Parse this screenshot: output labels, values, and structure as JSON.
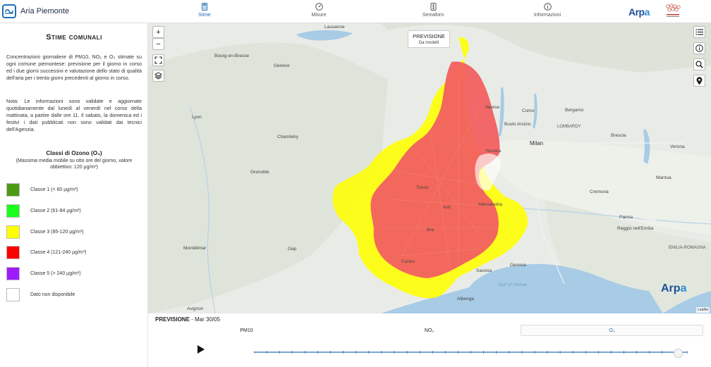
{
  "app": {
    "title": "Aria Piemonte"
  },
  "nav": {
    "tabs": [
      {
        "label": "Stime",
        "icon": "calculator-icon",
        "active": true
      },
      {
        "label": "Misure",
        "icon": "gauge-icon",
        "active": false
      },
      {
        "label": "Semaforo",
        "icon": "traffic-light-icon",
        "active": false
      },
      {
        "label": "Informazioni",
        "icon": "info-icon",
        "active": false
      }
    ],
    "logo_text_a": "Arp",
    "logo_text_b": "a"
  },
  "sidebar": {
    "title": "Stime comunali",
    "intro": "Concentrazioni giornaliere di PM10, NO₂ e O₃ stimate su ogni comune piemontese: previsione per il giorno in corso ed i due giorni successivi e valutazione dello stato di qualità dell'aria per i trenta giorni precedenti al giorno in corso.",
    "note": "Nota: Le informazioni sono validate e aggiornate quotidianamente dal lunedì al venerdì nel corso della mattinata, a partire dalle ore 11. Il sabato, la domenica ed i festivi i dati pubblicati non sono validati dai tecnici dell'Agenzia.",
    "legend_title": "Classi di Ozono (O₃)",
    "legend_subtitle": "(Massima media mobile su otto ore del giorno, valore obbiettivo: 120 µg/m³)",
    "legend": [
      {
        "label": "Classe 1 (< 60 µg/m³)",
        "color": "#4c9a14"
      },
      {
        "label": "Classe 2 (61-84 µg/m³)",
        "color": "#19ff19"
      },
      {
        "label": "Classe 3 (85-120 µg/m³)",
        "color": "#ffff00"
      },
      {
        "label": "Classe 4 (121-240 µg/m³)",
        "color": "#ff0000"
      },
      {
        "label": "Classe 5 (> 240 µg/m³)",
        "color": "#a01aff"
      },
      {
        "label": "Dato non disponibile",
        "color": "#ffffff"
      }
    ]
  },
  "map": {
    "badge_title": "PREVISIONE",
    "badge_sub": "Da modelli",
    "zoom_in": "+",
    "zoom_out": "−",
    "attribution": "Leaflet",
    "labels": {
      "lausanne": "Lausanne",
      "geneva": "Genève",
      "lyon": "Lyon",
      "chambery": "Chambéry",
      "grenoble": "Grenoble",
      "milan": "Milan",
      "torino": "Torino",
      "novara": "Novara",
      "como": "Como",
      "bergamo": "Bergamo",
      "brescia": "Brescia",
      "varese": "Varese",
      "cremona": "Cremona",
      "parma": "Parma",
      "reggio": "Reggio nell'Emilia",
      "genova": "Genova",
      "savona": "Savona",
      "albenga": "Albenga",
      "gulf": "Gulf of Genoa",
      "mantua": "Mantua",
      "verona": "Verona",
      "montelimar": "Montélimar",
      "gap": "Gap",
      "avignon": "Avignon",
      "bourg": "Bourg-en-Bresse",
      "lombardy": "LOMBARDY",
      "emilia": "EMILIA-ROMAGNA",
      "alessandria": "Alessandria",
      "cuneo": "Cuneo",
      "asti": "Asti",
      "bra": "Bra",
      "busto": "Busto Arsizio"
    }
  },
  "bottom": {
    "mode": "PREVISIONE",
    "date": " - Mar 30/05",
    "tabs": [
      "PM10",
      "NO₂",
      "O₃"
    ],
    "active_tab": 2
  }
}
